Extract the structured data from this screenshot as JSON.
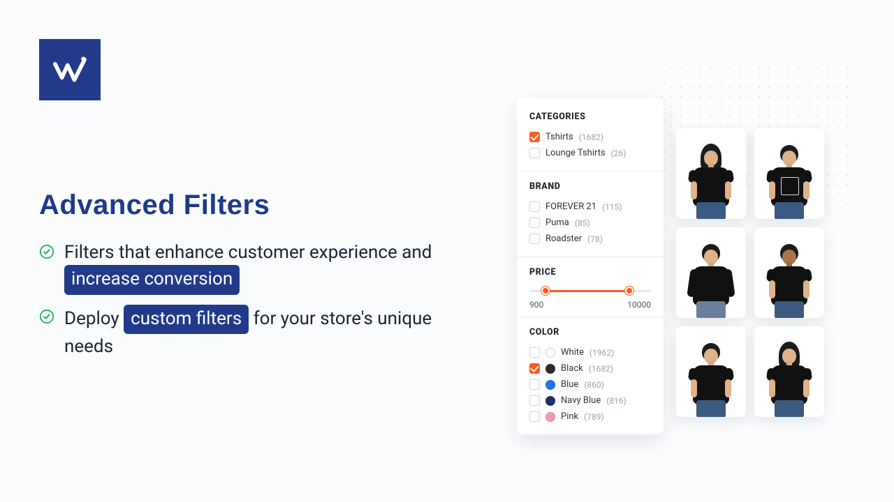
{
  "logo": {
    "letter": "W"
  },
  "headline": "Advanced Filters",
  "bullets": [
    {
      "pre": "Filters that enhance customer experience and ",
      "highlight": "increase conversion",
      "post": ""
    },
    {
      "pre": "Deploy ",
      "highlight": "custom filters",
      "post": " for your store's unique needs"
    }
  ],
  "panel": {
    "sections": {
      "categories": {
        "title": "CATEGORIES",
        "items": [
          {
            "label": "Tshirts",
            "count": "(1682)",
            "checked": true
          },
          {
            "label": "Lounge Tshirts",
            "count": "(26)",
            "checked": false
          }
        ]
      },
      "brand": {
        "title": "BRAND",
        "items": [
          {
            "label": "FOREVER 21",
            "count": "(115)",
            "checked": false
          },
          {
            "label": "Puma",
            "count": "(85)",
            "checked": false
          },
          {
            "label": "Roadster",
            "count": "(78)",
            "checked": false
          }
        ]
      },
      "price": {
        "title": "PRICE",
        "min": "900",
        "max": "10000",
        "low_pct": 13,
        "high_pct": 82
      },
      "color": {
        "title": "COLOR",
        "items": [
          {
            "label": "White",
            "count": "(1962)",
            "checked": false,
            "hex": "#ffffff"
          },
          {
            "label": "Black",
            "count": "(1682)",
            "checked": true,
            "hex": "#2b2b2b"
          },
          {
            "label": "Blue",
            "count": "(860)",
            "checked": false,
            "hex": "#1e73e8"
          },
          {
            "label": "Navy Blue",
            "count": "(816)",
            "checked": false,
            "hex": "#1f2f6a"
          },
          {
            "label": "Pink",
            "count": "(789)",
            "checked": false,
            "hex": "#f495b9"
          }
        ]
      }
    }
  },
  "colors": {
    "brand": "#213b8a",
    "accent": "#ff5a1f",
    "check": "#1eb65a"
  }
}
